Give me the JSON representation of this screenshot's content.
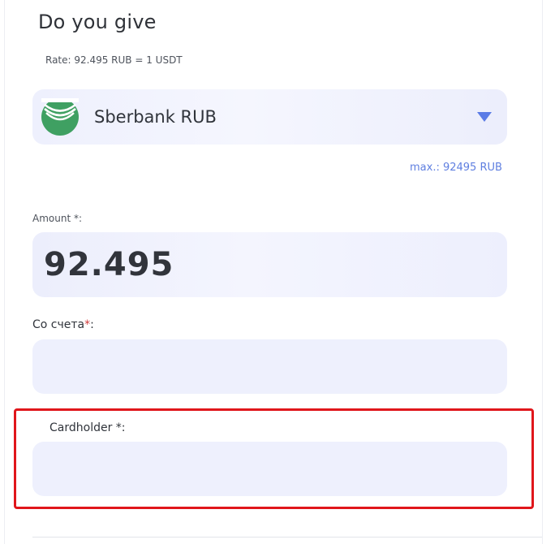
{
  "section": {
    "title": "Do you give",
    "rate": "Rate: 92.495 RUB = 1 USDT"
  },
  "currency_select": {
    "selected_label": "Sberbank RUB",
    "logo_icon": "sberbank-logo-icon",
    "arrow_icon": "triangle-down-icon",
    "accent_color": "#5f7fe0"
  },
  "max_link": "max.: 92495 RUB",
  "amount": {
    "label": "Amount *:",
    "value": "92.495"
  },
  "account": {
    "label": "Со счета",
    "required_mark": "*",
    "suffix": ":",
    "value": ""
  },
  "cardholder": {
    "label": "Cardholder *:",
    "value": ""
  },
  "highlight": {
    "color": "#e0161b",
    "target": "cardholder-field"
  }
}
